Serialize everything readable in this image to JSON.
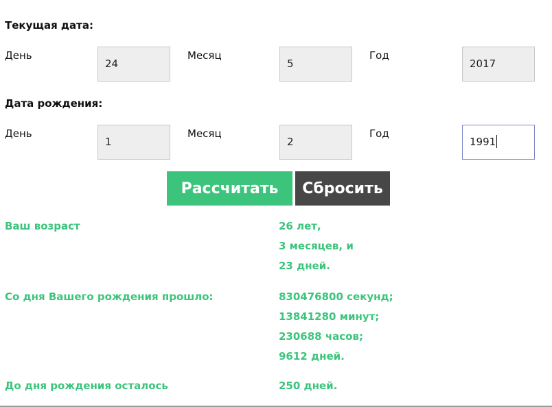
{
  "current_date": {
    "title": "Текущая дата:",
    "day_label": "День",
    "day_value": "24",
    "month_label": "Месяц",
    "month_value": "5",
    "year_label": "Год",
    "year_value": "2017"
  },
  "birth_date": {
    "title": "Дата рождения:",
    "day_label": "День",
    "day_value": "1",
    "month_label": "Месяц",
    "month_value": "2",
    "year_label": "Год",
    "year_value": "1991"
  },
  "buttons": {
    "calculate": "Рассчитать",
    "reset": "Сбросить"
  },
  "results": {
    "age_label": "Ваш возраст",
    "age_lines": [
      "26 лет,",
      "3 месяцев, и",
      "23 дней."
    ],
    "elapsed_label": "Со дня Вашего рождения прошло:",
    "elapsed_lines": [
      "830476800 секунд;",
      "13841280 минут;",
      "230688 часов;",
      "9612 дней."
    ],
    "until_label": "До дня рождения осталось",
    "until_value": "250 дней."
  },
  "colors": {
    "accent_green": "#3cc47c",
    "reset_gray": "#474747",
    "input_bg": "#eeeeee",
    "focus_border": "#7d86c9"
  }
}
